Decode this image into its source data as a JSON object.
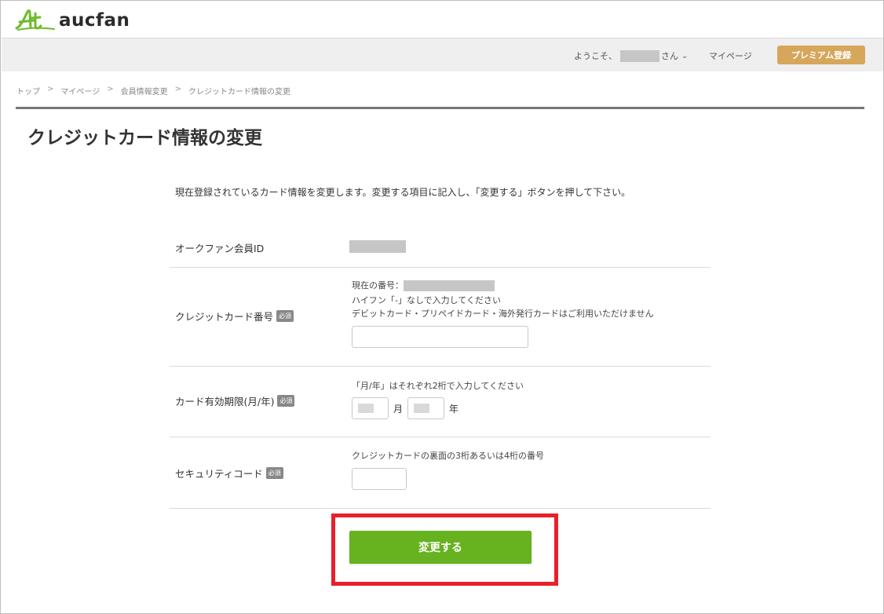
{
  "header": {
    "logo_text": "aucfan",
    "welcome_prefix": "ようこそ、",
    "welcome_suffix": "さん",
    "mypage_label": "マイページ",
    "premium_label": "プレミアム登録"
  },
  "breadcrumb": [
    "トップ",
    "マイページ",
    "会員情報変更",
    "クレジットカード情報の変更"
  ],
  "breadcrumb_separator": ">",
  "page": {
    "title": "クレジットカード情報の変更",
    "intro": "現在登録されているカード情報を変更します。変更する項目に記入し、「変更する」ボタンを押して下さい。"
  },
  "required_badge": "必須",
  "form": {
    "member_id_label": "オークファン会員ID",
    "card_number": {
      "label": "クレジットカード番号",
      "current_prefix": "現在の番号：",
      "note1": "ハイフン「-」なしで入力してください",
      "note2": "デビットカード・プリペイドカード・海外発行カードはご利用いただけません",
      "value": ""
    },
    "expiry": {
      "label": "カード有効期限(月/年)",
      "note": "「月/年」はそれぞれ2桁で入力してください",
      "month_unit": "月",
      "year_unit": "年"
    },
    "security": {
      "label": "セキュリティコード",
      "note": "クレジットカードの裏面の3桁あるいは4桁の番号",
      "value": ""
    }
  },
  "submit_label": "変更する",
  "colors": {
    "submit": "#66b21f",
    "premium": "#d6a65a",
    "highlight": "#e8202a",
    "logo_green": "#6dbb2b"
  }
}
